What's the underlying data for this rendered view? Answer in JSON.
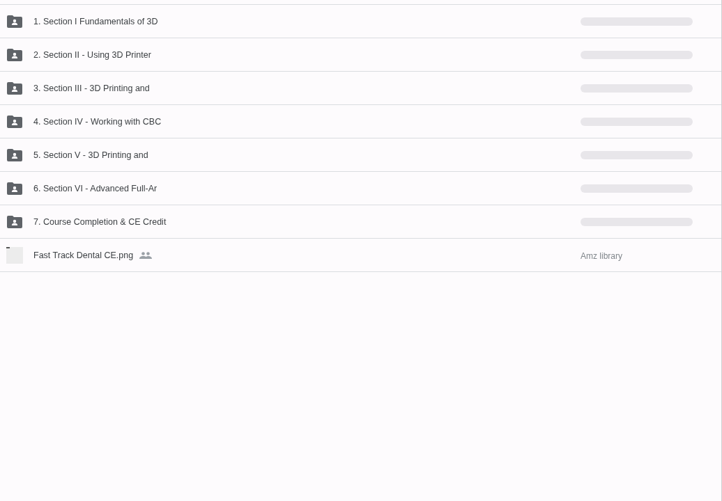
{
  "items": [
    {
      "kind": "folder",
      "name": "1. Section I Fundamentals of 3D",
      "shared": false,
      "location_loading": true
    },
    {
      "kind": "folder",
      "name": "2. Section II - Using 3D Printer",
      "shared": false,
      "location_loading": true
    },
    {
      "kind": "folder",
      "name": "3. Section III - 3D Printing and",
      "shared": false,
      "location_loading": true
    },
    {
      "kind": "folder",
      "name": "4. Section IV - Working with CBC",
      "shared": false,
      "location_loading": true
    },
    {
      "kind": "folder",
      "name": "5. Section V - 3D Printing and",
      "shared": false,
      "location_loading": true
    },
    {
      "kind": "folder",
      "name": "6. Section VI - Advanced Full-Ar",
      "shared": false,
      "location_loading": true
    },
    {
      "kind": "folder",
      "name": "7. Course Completion & CE Credit",
      "shared": false,
      "location_loading": true
    },
    {
      "kind": "file",
      "name": "Fast Track Dental CE.png",
      "shared": true,
      "location_loading": false,
      "location": "Amz library"
    }
  ]
}
